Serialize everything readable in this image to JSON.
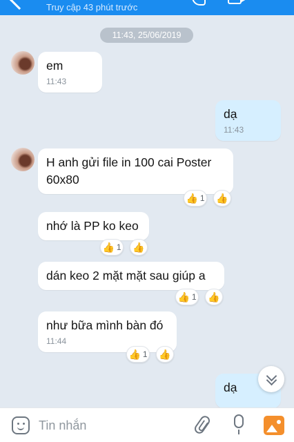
{
  "header": {
    "status": "Truy cập 43 phút trước"
  },
  "timestamp": "11:43, 25/06/2019",
  "messages": [
    {
      "text": "em",
      "time": "11:43"
    },
    {
      "text": "dạ",
      "time": "11:43"
    },
    {
      "text": "H anh gửi file in 100 cai Poster 60x80",
      "reaction_count": "1"
    },
    {
      "text": "nhớ là PP ko keo",
      "reaction_count": "1"
    },
    {
      "text": "dán keo 2 mặt mặt sau giúp a",
      "reaction_count": "1"
    },
    {
      "text": "như bữa mình bàn đó",
      "time": "11:44",
      "reaction_count": "1"
    },
    {
      "text": "dạ"
    }
  ],
  "reaction": {
    "emoji": "👍"
  },
  "composer": {
    "placeholder": "Tin nhắn"
  }
}
